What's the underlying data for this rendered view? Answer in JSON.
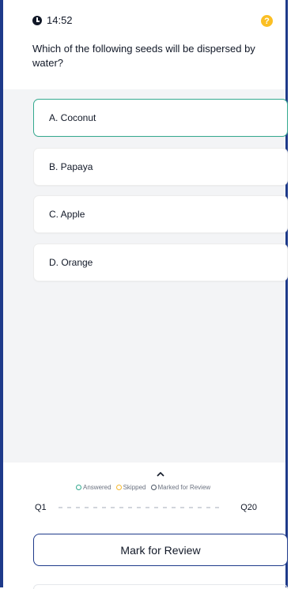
{
  "timer": {
    "value": "14:52",
    "icon": "clock-icon"
  },
  "help": {
    "icon": "help-icon",
    "glyph": "?"
  },
  "question": {
    "text": "Which of the following seeds will be dispersed by water?"
  },
  "options": [
    {
      "label": "A. Coconut",
      "selected": true
    },
    {
      "label": "B. Papaya",
      "selected": false
    },
    {
      "label": "C. Apple",
      "selected": false
    },
    {
      "label": "D. Orange",
      "selected": false
    }
  ],
  "legend": {
    "answered": "Answered",
    "skipped": "Skipped",
    "marked": "Marked for Review",
    "colors": {
      "answered": "#34a98f",
      "skipped": "#f5b82e",
      "marked": "#4b5563"
    }
  },
  "progress": {
    "start": "Q1",
    "end": "Q20"
  },
  "actions": {
    "mark_for_review": "Mark for Review"
  },
  "colors": {
    "accent": "#1e3a8a",
    "selected_border": "#34a98f",
    "help": "#fbbf24"
  }
}
